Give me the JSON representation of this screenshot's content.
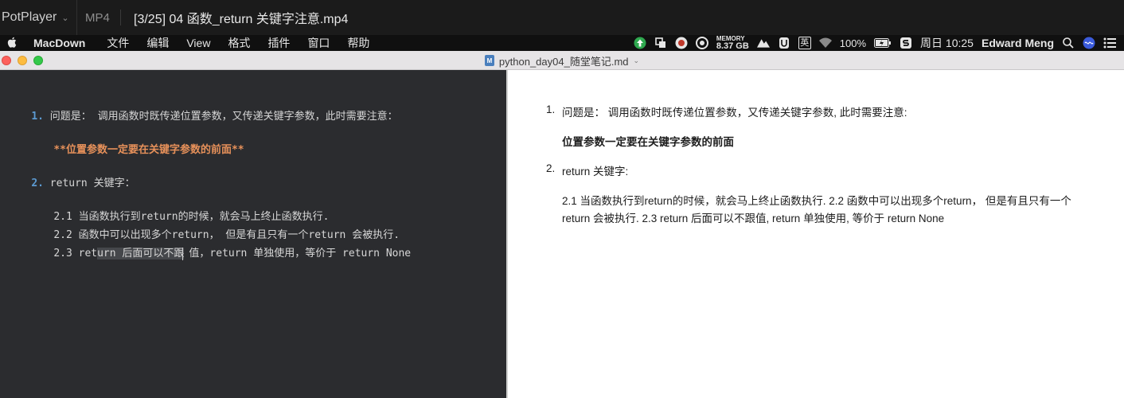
{
  "potplayer": {
    "brand": "PotPlayer",
    "format": "MP4",
    "title": "[3/25] 04 函数_return 关键字注意.mp4"
  },
  "menubar": {
    "app_name": "MacDown",
    "items": [
      "文件",
      "编辑",
      "View",
      "格式",
      "插件",
      "窗口",
      "帮助"
    ],
    "memory_label": "MEMORY",
    "memory_value": "8.37 GB",
    "ime_label": "英",
    "battery": "100%",
    "clock": "周日 10:25",
    "user": "Edward Meng"
  },
  "window": {
    "doc_title": "python_day04_随堂笔记.md"
  },
  "editor": {
    "l1_num": "1.",
    "l1_text": " 问题是： 调用函数时既传递位置参数，又传递关键字参数，此时需要注意：",
    "l2_text": "**位置参数一定要在关键字参数的前面**",
    "l3_num": "2.",
    "l3_text": " return 关键字：",
    "l4_text": "2.1 当函数执行到return的时候，就会马上终止函数执行.",
    "l5_text": "2.2 函数中可以出现多个return， 但是有且只有一个return 会被执行.",
    "l6_a": "2.3 ret",
    "l6_b": "urn 后面可以不跟",
    "l6_c": "值，return 单独使用，等价于 return None"
  },
  "preview": {
    "l1_num": "1.",
    "l1_text": "问题是： 调用函数时既传递位置参数，又传递关键字参数, 此时需要注意:",
    "l2_text": "位置参数一定要在关键字参数的前面",
    "l3_num": "2.",
    "l3_text": "return 关键字:",
    "l4_text": "2.1 当函数执行到return的时候，就会马上终止函数执行. 2.2 函数中可以出现多个return， 但是有且只有一个",
    "l5_text": "return 会被执行. 2.3 return 后面可以不跟值, return 单独使用, 等价于 return None"
  }
}
